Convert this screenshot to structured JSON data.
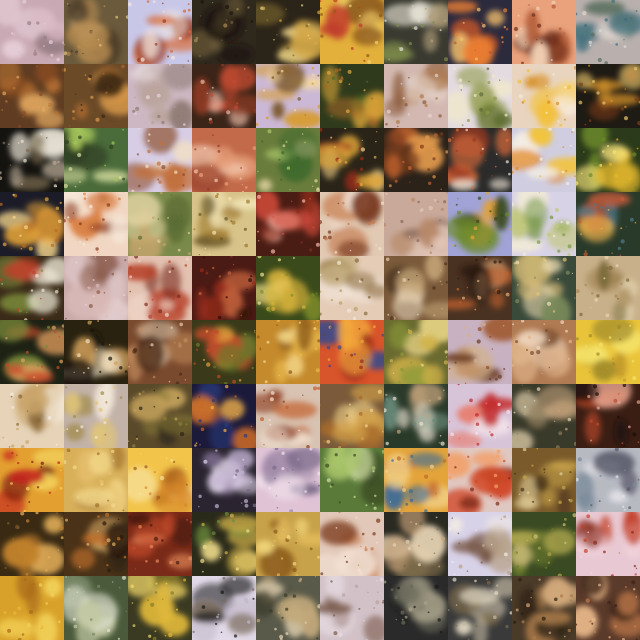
{
  "grid": {
    "rows": 10,
    "cols": 10,
    "tiles": [
      {
        "bg": "#c9a9b3",
        "blobs": [
          "#e6cfd8",
          "#9a7f86",
          "#d9b8c4"
        ]
      },
      {
        "bg": "#6b5a3c",
        "blobs": [
          "#b58a4f",
          "#e1c089",
          "#4a3a28"
        ]
      },
      {
        "bg": "#c9c7e8",
        "blobs": [
          "#d8672e",
          "#9b3a1d",
          "#f1e7e0"
        ]
      },
      {
        "bg": "#2f281c",
        "blobs": [
          "#6d5b3a",
          "#a88b54",
          "#1a1510"
        ]
      },
      {
        "bg": "#2b2418",
        "blobs": [
          "#d2a747",
          "#7f6a2e",
          "#f0d68a"
        ]
      },
      {
        "bg": "#e2b03b",
        "blobs": [
          "#c0392b",
          "#f5d26b",
          "#8e5b1b"
        ]
      },
      {
        "bg": "#3a3a30",
        "blobs": [
          "#e7e3d5",
          "#7e8c4a",
          "#b2a07a"
        ]
      },
      {
        "bg": "#2c2a3d",
        "blobs": [
          "#ea7e33",
          "#c0542a",
          "#f4c06c"
        ]
      },
      {
        "bg": "#e9a27c",
        "blobs": [
          "#6b2c1b",
          "#f3d2b5",
          "#b05a36"
        ]
      },
      {
        "bg": "#b9b0ad",
        "blobs": [
          "#3d6d7a",
          "#e2d8d1",
          "#5a6e5e"
        ]
      },
      {
        "bg": "#5f3c22",
        "blobs": [
          "#b87333",
          "#8b4c22",
          "#e0a760"
        ]
      },
      {
        "bg": "#6b4a28",
        "blobs": [
          "#a9692f",
          "#d99a4b",
          "#3d2814"
        ]
      },
      {
        "bg": "#cdb7c2",
        "blobs": [
          "#b9a39a",
          "#e3d6dc",
          "#8e7a73"
        ]
      },
      {
        "bg": "#3b2418",
        "blobs": [
          "#c24a30",
          "#e5b7a2",
          "#8d3a22"
        ]
      },
      {
        "bg": "#cbb8d6",
        "blobs": [
          "#d79b2a",
          "#7a5628",
          "#f5d9a0"
        ]
      },
      {
        "bg": "#2f3a1c",
        "blobs": [
          "#e0a83a",
          "#4f6b24",
          "#a76b26"
        ]
      },
      {
        "bg": "#d2b8b0",
        "blobs": [
          "#8a5a3a",
          "#b07a4c",
          "#e6d4ca"
        ]
      },
      {
        "bg": "#e4dbe0",
        "blobs": [
          "#8e9a45",
          "#f1e9c9",
          "#5c6b30"
        ]
      },
      {
        "bg": "#e8d4bf",
        "blobs": [
          "#f2c13a",
          "#d88f22",
          "#f7e9d9"
        ]
      },
      {
        "bg": "#1e1a14",
        "blobs": [
          "#d1902a",
          "#7f3c1a",
          "#e8c46a"
        ]
      },
      {
        "bg": "#14130f",
        "blobs": [
          "#e8e2d4",
          "#7a6a4f",
          "#b7a894"
        ]
      },
      {
        "bg": "#4a6b3a",
        "blobs": [
          "#a4c45b",
          "#dbe0a2",
          "#2f3e22"
        ]
      },
      {
        "bg": "#d7cde5",
        "blobs": [
          "#c2703c",
          "#f0dec5",
          "#8b4c2a"
        ]
      },
      {
        "bg": "#c26a4a",
        "blobs": [
          "#e7a07b",
          "#8e3a24",
          "#f3c9b0"
        ]
      },
      {
        "bg": "#6a7c3c",
        "blobs": [
          "#3f6a2c",
          "#a9c86a",
          "#e2d1a0"
        ]
      },
      {
        "bg": "#2a2418",
        "blobs": [
          "#e2a83a",
          "#9b2c18",
          "#f5d68a"
        ]
      },
      {
        "bg": "#2b221a",
        "blobs": [
          "#c5642e",
          "#e39a4c",
          "#7a3c1e"
        ]
      },
      {
        "bg": "#2a2b2a",
        "blobs": [
          "#d76b3a",
          "#f0e5d8",
          "#9a3a22"
        ]
      },
      {
        "bg": "#d0cde0",
        "blobs": [
          "#f2c33d",
          "#e38a28",
          "#f5efe4"
        ]
      },
      {
        "bg": "#2b3a1a",
        "blobs": [
          "#e1b62c",
          "#6b8a2a",
          "#f5e27a"
        ]
      },
      {
        "bg": "#1c1c28",
        "blobs": [
          "#e4a43a",
          "#b86b22",
          "#f5d58a"
        ]
      },
      {
        "bg": "#f1d7c3",
        "blobs": [
          "#8a3a1c",
          "#d87a3a",
          "#f7e8d9"
        ]
      },
      {
        "bg": "#7a8a4a",
        "blobs": [
          "#c2a46a",
          "#5a6b32",
          "#e1d3a2"
        ]
      },
      {
        "bg": "#d8c48a",
        "blobs": [
          "#a07a2e",
          "#f2e6b8",
          "#6b5a2a"
        ]
      },
      {
        "bg": "#4a1d14",
        "blobs": [
          "#d24a3a",
          "#8a2c1c",
          "#f2b6a6"
        ]
      },
      {
        "bg": "#e1c9b3",
        "blobs": [
          "#7a3c24",
          "#c57a4c",
          "#f1e0d0"
        ]
      },
      {
        "bg": "#c8a99a",
        "blobs": [
          "#e3c7b8",
          "#8a6a5a",
          "#b88a6a"
        ]
      },
      {
        "bg": "#a1a2d6",
        "blobs": [
          "#6b8a2a",
          "#e1a43a",
          "#3a4a1c"
        ]
      },
      {
        "bg": "#d8d2e6",
        "blobs": [
          "#7a9a4a",
          "#c2c77a",
          "#f0ead8"
        ]
      },
      {
        "bg": "#2a3a2a",
        "blobs": [
          "#c25a3a",
          "#4a7a8a",
          "#e3b04a"
        ]
      },
      {
        "bg": "#3a2a18",
        "blobs": [
          "#e8e2cf",
          "#7a8a3a",
          "#c0422a"
        ]
      },
      {
        "bg": "#c8a9a7",
        "blobs": [
          "#e5cfd1",
          "#8a5a4a",
          "#d9b9b6"
        ]
      },
      {
        "bg": "#e3c2b2",
        "blobs": [
          "#b8452c",
          "#f0d7c9",
          "#7a2c1c"
        ]
      },
      {
        "bg": "#4a1a14",
        "blobs": [
          "#9a2c1c",
          "#c2603a",
          "#2a0e0a"
        ]
      },
      {
        "bg": "#3a4a1a",
        "blobs": [
          "#d7b23a",
          "#7a8a2a",
          "#f2e08a"
        ]
      },
      {
        "bg": "#e4ccb7",
        "blobs": [
          "#8a6a3a",
          "#f4e8dc",
          "#b8a06a"
        ]
      },
      {
        "bg": "#7a5a3a",
        "blobs": [
          "#c8a77a",
          "#4a3422",
          "#e3cfb0"
        ]
      },
      {
        "bg": "#4a3222",
        "blobs": [
          "#c4622c",
          "#e3ad7a",
          "#2a1a10"
        ]
      },
      {
        "bg": "#3a4a3a",
        "blobs": [
          "#e0c27a",
          "#7a8a5a",
          "#f2e2b8"
        ]
      },
      {
        "bg": "#c8b08a",
        "blobs": [
          "#7a6a3a",
          "#e6d6b2",
          "#a88a5a"
        ]
      },
      {
        "bg": "#1d2214",
        "blobs": [
          "#c84a2a",
          "#7a8a3a",
          "#e5a060"
        ]
      },
      {
        "bg": "#2a2210",
        "blobs": [
          "#f1e2c3",
          "#d0a05a",
          "#1a140a"
        ]
      },
      {
        "bg": "#7a4a2e",
        "blobs": [
          "#c08a5a",
          "#e9d0b2",
          "#4a2a18"
        ]
      },
      {
        "bg": "#3a3a1a",
        "blobs": [
          "#c24a2a",
          "#6a7a2a",
          "#e0a03a"
        ]
      },
      {
        "bg": "#c48a2c",
        "blobs": [
          "#e9b84a",
          "#8a5a1a",
          "#f5d88a"
        ]
      },
      {
        "bg": "#d8542a",
        "blobs": [
          "#f2a93a",
          "#3a4a8a",
          "#9a2c1c"
        ]
      },
      {
        "bg": "#6a6a30",
        "blobs": [
          "#d2b24a",
          "#8a9a3a",
          "#f0dc8a"
        ]
      },
      {
        "bg": "#c8b2c2",
        "blobs": [
          "#9a4a1c",
          "#d2b18a",
          "#6a3a22"
        ]
      },
      {
        "bg": "#b07a52",
        "blobs": [
          "#e0b48a",
          "#7a4a2a",
          "#f0d8c0"
        ]
      },
      {
        "bg": "#e9c43a",
        "blobs": [
          "#f5e36a",
          "#c29a2a",
          "#a08a2a"
        ]
      },
      {
        "bg": "#e6d3b8",
        "blobs": [
          "#c9a46a",
          "#f5ebdd",
          "#8a6a3a"
        ]
      },
      {
        "bg": "#c2b2a8",
        "blobs": [
          "#e0c47a",
          "#a08a4a",
          "#f1e6d8"
        ]
      },
      {
        "bg": "#5a4a2a",
        "blobs": [
          "#8a7a3a",
          "#c2a05a",
          "#2a2418"
        ]
      },
      {
        "bg": "#1c1a3a",
        "blobs": [
          "#c86a2a",
          "#2a3a7a",
          "#f2b24a"
        ]
      },
      {
        "bg": "#d8c2b2",
        "blobs": [
          "#8a3a1c",
          "#c2602a",
          "#f2e2d2"
        ]
      },
      {
        "bg": "#7a5a3a",
        "blobs": [
          "#d2a24a",
          "#a86a2a",
          "#f0d28a"
        ]
      },
      {
        "bg": "#2a3a2a",
        "blobs": [
          "#e8e0cf",
          "#6a8a7a",
          "#c2a27a"
        ]
      },
      {
        "bg": "#d8c4d8",
        "blobs": [
          "#c22a2a",
          "#e87a6a",
          "#f2e2ea"
        ]
      },
      {
        "bg": "#3a3a2a",
        "blobs": [
          "#e6d6b2",
          "#8a7a5a",
          "#c2a07a"
        ]
      },
      {
        "bg": "#3a1e14",
        "blobs": [
          "#c24a2a",
          "#e0a08a",
          "#1a0e0a"
        ]
      },
      {
        "bg": "#e3a030",
        "blobs": [
          "#c2221c",
          "#f2d05a",
          "#7a1a12"
        ]
      },
      {
        "bg": "#d8b05a",
        "blobs": [
          "#f2d88a",
          "#a0702a",
          "#e8c070"
        ]
      },
      {
        "bg": "#f2c44a",
        "blobs": [
          "#d88a2a",
          "#f7e09a",
          "#a05a1a"
        ]
      },
      {
        "bg": "#2a2430",
        "blobs": [
          "#e0d6e8",
          "#7a6a8a",
          "#c2b2d2"
        ]
      },
      {
        "bg": "#e0c4d6",
        "blobs": [
          "#a08aa8",
          "#f2e2ec",
          "#7a6a8a"
        ]
      },
      {
        "bg": "#5a7a3a",
        "blobs": [
          "#a8c46a",
          "#d2e0a2",
          "#3a4a22"
        ]
      },
      {
        "bg": "#e4a43a",
        "blobs": [
          "#3a6a9a",
          "#c26a2a",
          "#f2d28a"
        ]
      },
      {
        "bg": "#e0c8c2",
        "blobs": [
          "#d24a2a",
          "#f2a06a",
          "#7a2a1a"
        ]
      },
      {
        "bg": "#7a5a2a",
        "blobs": [
          "#c8a44a",
          "#e2cf9a",
          "#4a341a"
        ]
      },
      {
        "bg": "#b8bac2",
        "blobs": [
          "#7a8a9a",
          "#e2e2e8",
          "#5a5a6a"
        ]
      },
      {
        "bg": "#3a2a14",
        "blobs": [
          "#c2822a",
          "#7a5a2a",
          "#e8b25a"
        ]
      },
      {
        "bg": "#4a3218",
        "blobs": [
          "#c2702a",
          "#e0b06a",
          "#2a1a0c"
        ]
      },
      {
        "bg": "#7a2a18",
        "blobs": [
          "#c24a2a",
          "#e28a5a",
          "#4a1a0e"
        ]
      },
      {
        "bg": "#2a2a1a",
        "blobs": [
          "#d2b24a",
          "#6a8a3a",
          "#f0dc8a"
        ]
      },
      {
        "bg": "#c8a24a",
        "blobs": [
          "#f2d67a",
          "#8a5a1a",
          "#e0b85a"
        ]
      },
      {
        "bg": "#e2c8b8",
        "blobs": [
          "#7a3a1c",
          "#c87a4a",
          "#f2e0d2"
        ]
      },
      {
        "bg": "#2a2a22",
        "blobs": [
          "#c8a27a",
          "#7a6a4a",
          "#e6d2b2"
        ]
      },
      {
        "bg": "#d8d2e8",
        "blobs": [
          "#7a5a4a",
          "#b8a28a",
          "#f2ece4"
        ]
      },
      {
        "bg": "#3a4a22",
        "blobs": [
          "#a8a24a",
          "#6a7a2a",
          "#d2c27a"
        ]
      },
      {
        "bg": "#e8c8d2",
        "blobs": [
          "#c2422a",
          "#f2d2da",
          "#8a2a1c"
        ]
      },
      {
        "bg": "#d8a22a",
        "blobs": [
          "#f2d25a",
          "#a86a1a",
          "#e8b83a"
        ]
      },
      {
        "bg": "#4a5a3a",
        "blobs": [
          "#c2c8a2",
          "#7a8a6a",
          "#e2e4d2"
        ]
      },
      {
        "bg": "#3a3a22",
        "blobs": [
          "#e0b83a",
          "#8a7a2a",
          "#f2d86a"
        ]
      },
      {
        "bg": "#e2dae8",
        "blobs": [
          "#1a1a1a",
          "#c2b8c8",
          "#7a6a5a"
        ]
      },
      {
        "bg": "#5a5a4a",
        "blobs": [
          "#c2a87a",
          "#e2d2b2",
          "#3a3a2a"
        ]
      },
      {
        "bg": "#d2c2c8",
        "blobs": [
          "#7a5a4a",
          "#b8a2a2",
          "#e8dce2"
        ]
      },
      {
        "bg": "#2a2a2a",
        "blobs": [
          "#6a6a5a",
          "#a8a28a",
          "#1a1a1a"
        ]
      },
      {
        "bg": "#3a3a3a",
        "blobs": [
          "#c2b8a2",
          "#7a6a4a",
          "#e2d8c2"
        ]
      },
      {
        "bg": "#4a3a28",
        "blobs": [
          "#a87a4a",
          "#d2a87a",
          "#2a2014"
        ]
      },
      {
        "bg": "#5a3a2a",
        "blobs": [
          "#c27a4a",
          "#e8b88a",
          "#3a2418"
        ]
      }
    ]
  }
}
